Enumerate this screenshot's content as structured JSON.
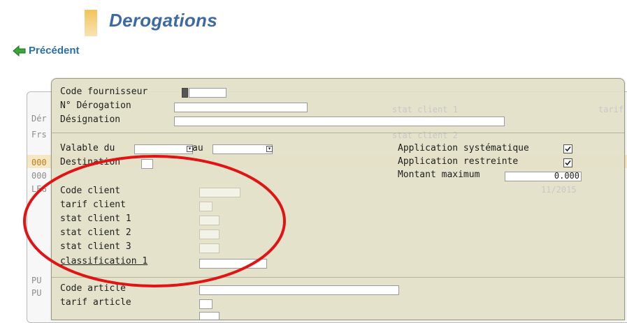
{
  "header": {
    "title": "Derogations",
    "back_label": "Précédent"
  },
  "background": {
    "left_labels": [
      "Dér",
      "Frs",
      "000",
      "000",
      "LEG",
      "PU",
      "PU"
    ],
    "faded_right": [
      "stat client 1",
      "stat client 2",
      "tarif",
      "11/2015"
    ]
  },
  "dialog": {
    "code_fournisseur_label": "Code fournisseur",
    "no_derogation_label": "N° Dérogation",
    "designation_label": "Désignation",
    "valable_du_label": "Valable du",
    "au_label": "au",
    "destination_label": "Destination",
    "application_systematique_label": "Application systématique",
    "application_systematique_checked": true,
    "application_restreinte_label": "Application restreinte",
    "application_restreinte_checked": true,
    "montant_maximum_label": "Montant maximum",
    "montant_maximum_value": "0.000",
    "client_fields": [
      "Code client",
      "tarif client",
      "stat client 1",
      "stat client 2",
      "stat client 3",
      "classification 1"
    ],
    "article_fields": [
      "Code article",
      "tarif article"
    ]
  },
  "colors": {
    "title": "#3d6aa6",
    "link": "#2a6fa7",
    "annotation_circle": "#e01414",
    "dialog_bg": "#e2e0c8"
  },
  "icons": {
    "back": "green-left-arrow-icon",
    "dropdown": "dropdown-arrow-icon",
    "checkbox": "checkmark-icon"
  }
}
